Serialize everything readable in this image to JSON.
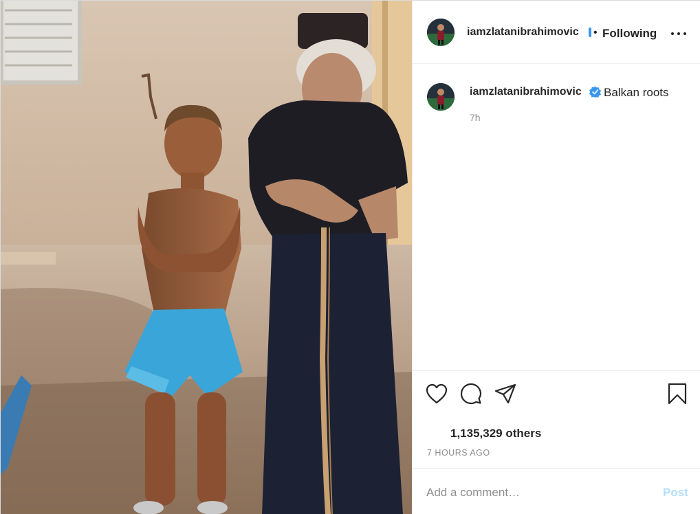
{
  "post": {
    "image_alt": "Boy in blue shorts and an elderly man with a walking stick standing against a wall",
    "author": {
      "username": "iamzlatanibrahimovic",
      "verified": true
    },
    "header": {
      "separator": "•",
      "follow_status": "Following"
    },
    "caption": {
      "username": "iamzlatanibrahimovic",
      "text": "Balkan roots",
      "time_ago": "7h"
    },
    "likes_text": "1,135,329 others",
    "posted_ago": "7 HOURS AGO",
    "comment": {
      "placeholder": "Add a comment…",
      "post_label": "Post"
    },
    "icons": {
      "like": "heart-icon",
      "comment": "comment-bubble-icon",
      "share": "paper-plane-icon",
      "save": "bookmark-icon",
      "more": "more-options-icon",
      "verified": "verified-badge-icon"
    },
    "colors": {
      "verified_blue": "#3897f0",
      "post_button_disabled": "#b2dffc",
      "secondary_text": "#8e8e8e"
    }
  }
}
